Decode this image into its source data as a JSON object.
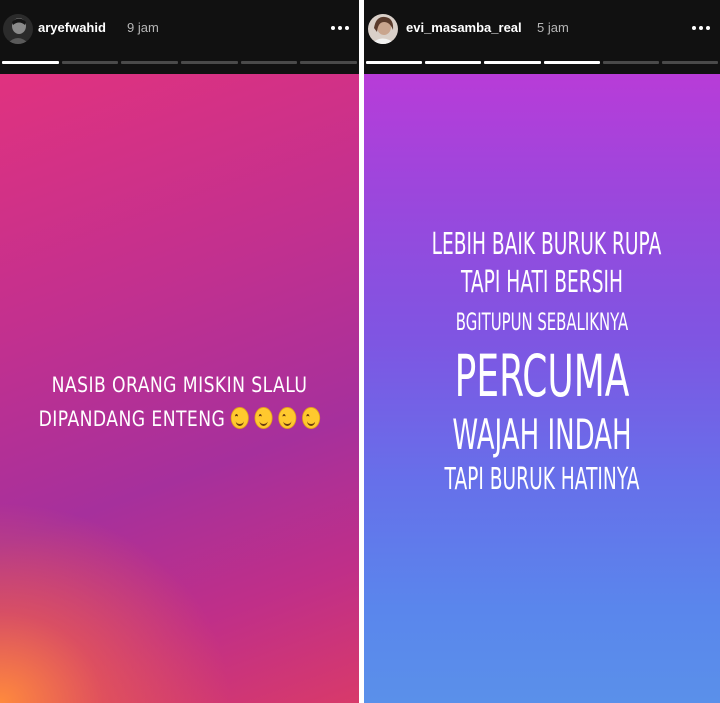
{
  "stories": [
    {
      "username": "aryefwahid",
      "time": "9 jam",
      "progress_segments": [
        1,
        0,
        0,
        0,
        0,
        0
      ],
      "caption": [
        "NASIB ORANG MISKIN SLALU",
        "DIPANDANG ENTENG"
      ],
      "emoji_count": 4,
      "emoji_name": "smiling-face-icon",
      "background_colors": [
        "#e0327f",
        "#a6309c",
        "#ff8a3d"
      ]
    },
    {
      "username": "evi_masamba_real",
      "time": "5 jam",
      "progress_segments": [
        1,
        1,
        1,
        1,
        0,
        0
      ],
      "caption": [
        "LEBIH BAIK BURUK RUPA",
        "TAPI HATI BERSIH",
        "BGITUPUN SEBALIKNYA",
        "PERCUMA",
        "WAJAH INDAH",
        "TAPI BURUK HATINYA"
      ],
      "background_colors": [
        "#b83cd8",
        "#7f55e2",
        "#5a90ea"
      ]
    }
  ]
}
